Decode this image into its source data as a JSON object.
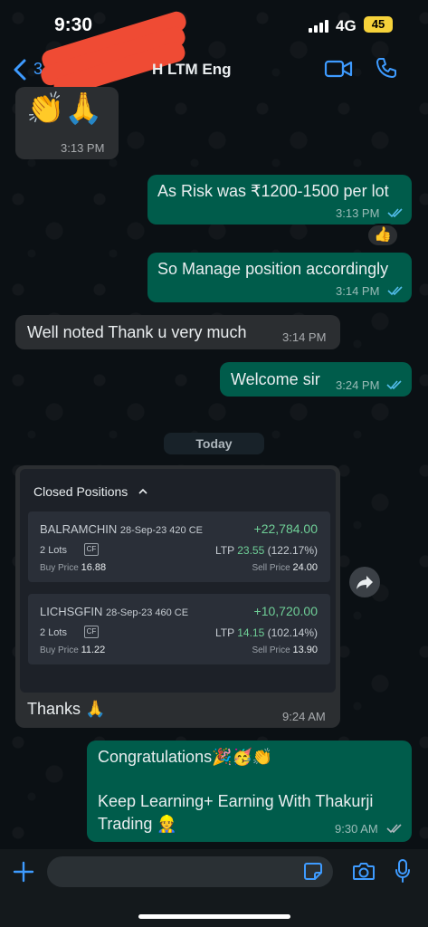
{
  "status_bar": {
    "time": "9:30",
    "network": "4G",
    "battery": "45"
  },
  "header": {
    "back_count": "3",
    "contact_name": "H LTM  Eng"
  },
  "colors": {
    "accent": "#3e9bff",
    "incoming_bubble": "#2b2e31",
    "outgoing_bubble": "#005c4b",
    "profit": "#6fcf97",
    "read_ticks": "#53bdeb"
  },
  "messages": [
    {
      "direction": "in",
      "text": "👏🙏",
      "time": "3:13 PM"
    },
    {
      "direction": "out",
      "text": "As Risk was ₹1200-1500 per lot",
      "time": "3:13 PM",
      "status": "read",
      "reaction": "👍"
    },
    {
      "direction": "out",
      "text": "So Manage position accordingly",
      "time": "3:14 PM",
      "status": "read"
    },
    {
      "direction": "in",
      "text": "Well noted Thank u very much",
      "time": "3:14 PM"
    },
    {
      "direction": "out",
      "text": "Welcome sir",
      "time": "3:24 PM",
      "status": "read"
    },
    {
      "direction": "in",
      "text": "Thanks 🙏",
      "time": "9:24 AM"
    },
    {
      "direction": "out",
      "text": "Congratulations🎉🥳👏",
      "text2": "Keep Learning+ Earning With Thakurji",
      "text3": "Trading 👷",
      "time": "9:30 AM",
      "status": "delivered"
    }
  ],
  "day_separator": "Today",
  "closed_positions": {
    "title": "Closed Positions",
    "items": [
      {
        "symbol": "BALRAMCHIN",
        "contract": "28-Sep-23 420 CE",
        "pnl": "+22,784.00",
        "lots": "2",
        "lots_label": "Lots",
        "cf": "CF",
        "ltp_label": "LTP",
        "ltp": "23.55",
        "ltp_change": "(122.17%)",
        "buy_label": "Buy Price",
        "buy_price": "16.88",
        "sell_label": "Sell Price",
        "sell_price": "24.00"
      },
      {
        "symbol": "LICHSGFIN",
        "contract": "28-Sep-23 460 CE",
        "pnl": "+10,720.00",
        "lots": "2",
        "lots_label": "Lots",
        "cf": "CF",
        "ltp_label": "LTP",
        "ltp": "14.15",
        "ltp_change": "(102.14%)",
        "buy_label": "Buy Price",
        "buy_price": "11.22",
        "sell_label": "Sell Price",
        "sell_price": "13.90"
      }
    ]
  },
  "input": {
    "placeholder": ""
  },
  "icons": [
    "back-icon",
    "video-call-icon",
    "phone-icon",
    "forward-icon",
    "plus-icon",
    "sticker-icon",
    "camera-icon",
    "mic-icon",
    "read-ticks-icon"
  ]
}
